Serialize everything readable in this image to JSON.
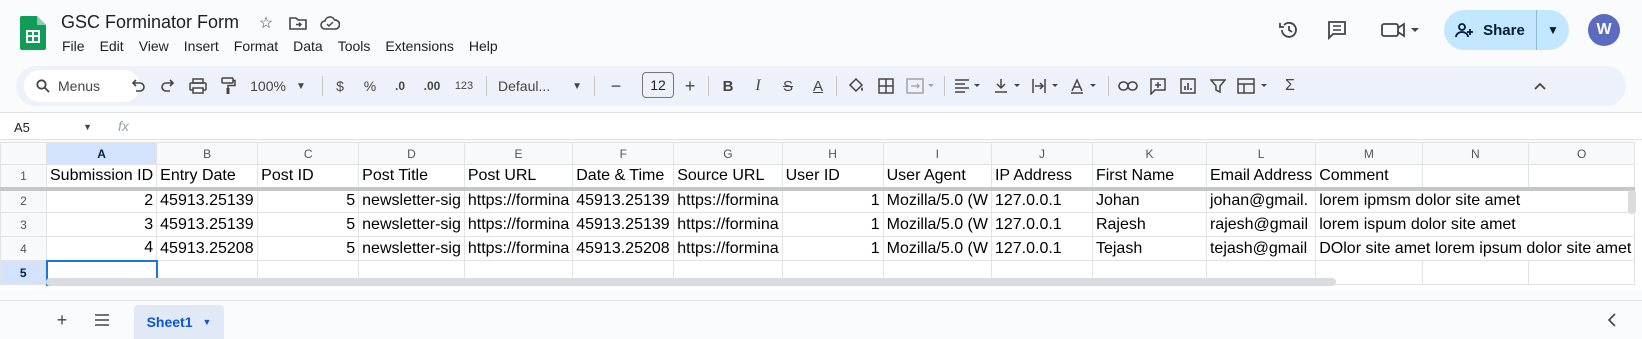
{
  "app": {
    "title": "GSC Forminator Form",
    "menu": [
      "File",
      "Edit",
      "View",
      "Insert",
      "Format",
      "Data",
      "Tools",
      "Extensions",
      "Help"
    ],
    "share_label": "Share",
    "avatar_initial": "W",
    "brand_color": "#0f9d58",
    "accent_color": "#c2e7ff"
  },
  "toolbar": {
    "search_label": "Menus",
    "zoom": "100%",
    "currency": "$",
    "percent": "%",
    "dec_decrease": ".0",
    "dec_increase": ".00",
    "number_format": "123",
    "font": "Defaul...",
    "font_size": "12",
    "minus": "−",
    "plus": "+",
    "bold": "B",
    "italic": "I",
    "strike": "S",
    "text_color": "A",
    "sigma": "Σ"
  },
  "formula_bar": {
    "name_box": "A5",
    "fx": "fx"
  },
  "grid": {
    "columns": [
      "A",
      "B",
      "C",
      "D",
      "E",
      "F",
      "G",
      "H",
      "I",
      "J",
      "K",
      "L",
      "M",
      "N",
      "O"
    ],
    "rows": [
      {
        "num": "1",
        "cells": [
          "Submission ID",
          "Entry Date",
          "Post ID",
          "Post Title",
          "Post URL",
          "Date & Time",
          "Source URL",
          "User ID",
          "User Agent",
          "IP Address",
          "First Name",
          "Email Address",
          "Comment",
          "",
          ""
        ]
      },
      {
        "num": "2",
        "cells": [
          "2",
          "45913.25139",
          "5",
          "newsletter-sig",
          "https://formina",
          "45913.25139",
          "https://formina",
          "1",
          "Mozilla/5.0 (W",
          "127.0.0.1",
          "Johan",
          "johan@gmail.",
          "lorem ipmsm dolor site amet",
          "",
          ""
        ]
      },
      {
        "num": "3",
        "cells": [
          "3",
          "45913.25139",
          "5",
          "newsletter-sig",
          "https://formina",
          "45913.25139",
          "https://formina",
          "1",
          "Mozilla/5.0 (W",
          "127.0.0.1",
          "Rajesh",
          "rajesh@gmail",
          "lorem ispum dolor site amet",
          "",
          ""
        ]
      },
      {
        "num": "4",
        "cells": [
          "4",
          "45913.25208",
          "5",
          "newsletter-sig",
          "https://formina",
          "45913.25208",
          "https://formina",
          "1",
          "Mozilla/5.0 (W",
          "127.0.0.1",
          "Tejash",
          "tejash@gmail",
          "DOlor site amet lorem ipsum dolor site amet",
          "",
          ""
        ]
      },
      {
        "num": "5",
        "cells": [
          "",
          "",
          "",
          "",
          "",
          "",
          "",
          "",
          "",
          "",
          "",
          "",
          "",
          "",
          ""
        ]
      }
    ]
  },
  "sheets": {
    "active": "Sheet1"
  }
}
